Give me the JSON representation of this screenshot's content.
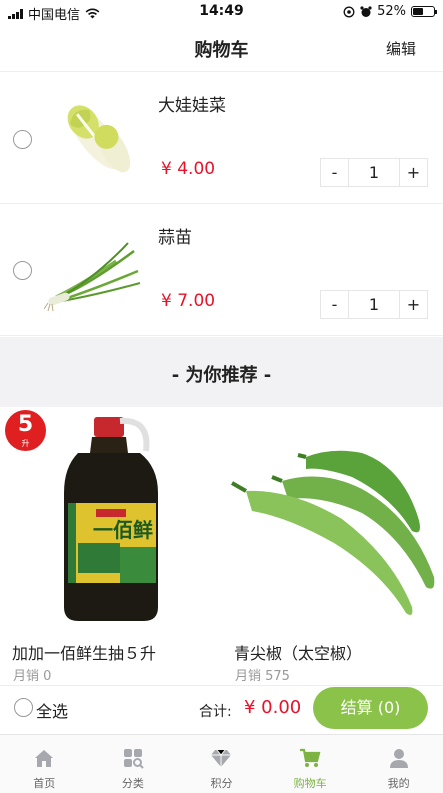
{
  "status_bar": {
    "carrier": "中国电信",
    "time": "14:49",
    "battery": "52%",
    "battery_level": 0.52
  },
  "header": {
    "title": "购物车",
    "edit_label": "编辑"
  },
  "cart_items": [
    {
      "name": "大娃娃菜",
      "price": "¥ 4.00",
      "quantity": "1",
      "minus": "-",
      "plus": "+"
    },
    {
      "name": "蒜苗",
      "price": "¥ 7.00",
      "quantity": "1",
      "minus": "-",
      "plus": "+"
    }
  ],
  "recommend": {
    "title": "-  为你推荐  -",
    "products": [
      {
        "name": "加加一佰鲜生抽５升",
        "sales": "月销 0",
        "badge_num": "5",
        "badge_unit": "升",
        "bottle_label": "一佰鲜"
      },
      {
        "name": "青尖椒（太空椒）",
        "sales": "月销 575"
      }
    ]
  },
  "checkout": {
    "select_all": "全选",
    "total_label": "合计:",
    "total_value": "¥ 0.00",
    "pay_button": "结算 (0)"
  },
  "tabbar": [
    {
      "label": "首页",
      "icon": "home-icon",
      "active": false
    },
    {
      "label": "分类",
      "icon": "category-icon",
      "active": false
    },
    {
      "label": "积分",
      "icon": "diamond-icon",
      "active": false
    },
    {
      "label": "购物车",
      "icon": "cart-icon",
      "active": true
    },
    {
      "label": "我的",
      "icon": "user-icon",
      "active": false
    }
  ],
  "colors": {
    "accent_green": "#8bc34a",
    "price_red": "#e8132a",
    "tab_active": "#7cb342",
    "tab_inactive": "#a6a8ad"
  }
}
